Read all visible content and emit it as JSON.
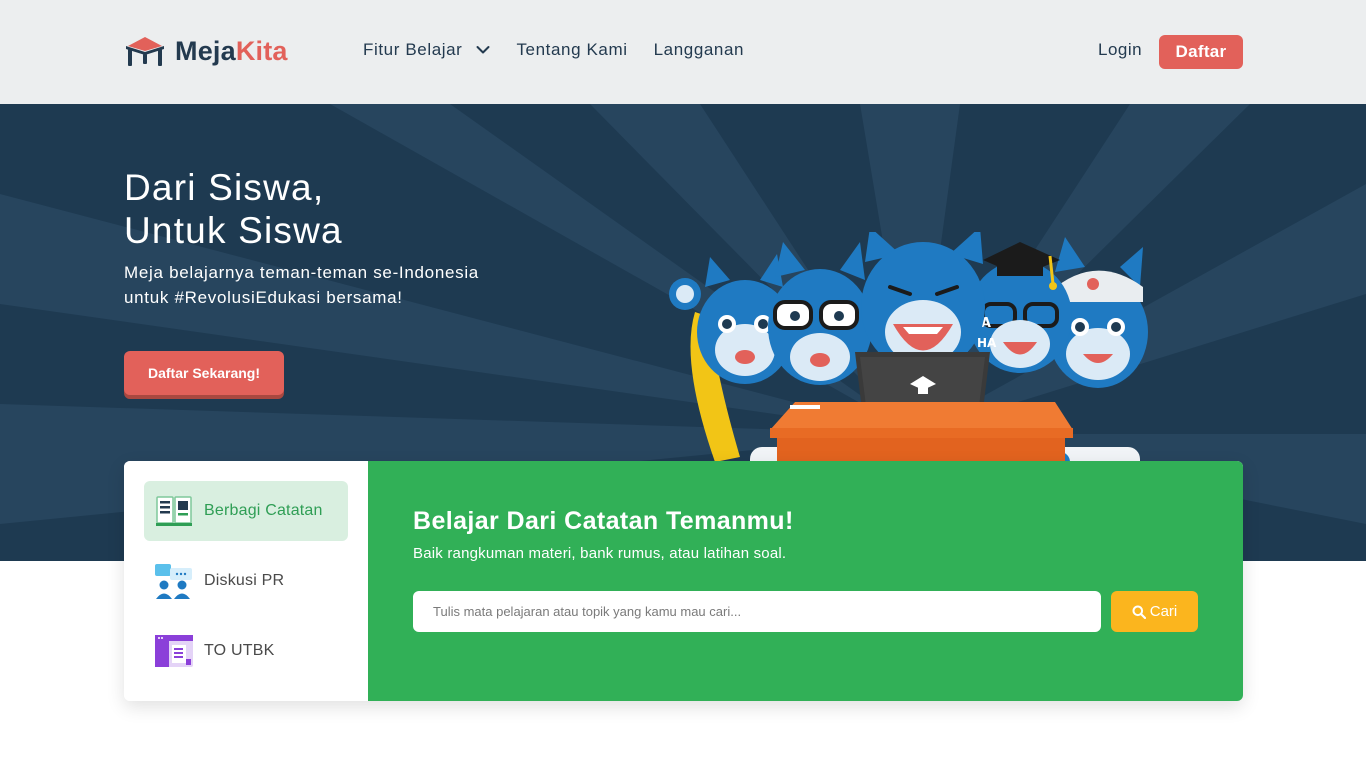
{
  "brand": {
    "name_part1": "Meja",
    "name_part2": "Kita"
  },
  "nav": {
    "items": [
      {
        "label": "Fitur Belajar"
      },
      {
        "label": "Tentang Kami"
      },
      {
        "label": "Langganan"
      }
    ],
    "login_label": "Login",
    "signup_label": "Daftar"
  },
  "hero": {
    "title_line1": "Dari Siswa,",
    "title_line2": "Untuk Siswa",
    "subtitle_line1": "Meja belajarnya teman-teman se-Indonesia",
    "subtitle_line2": "untuk #RevolusiEdukasi bersama!",
    "cta_label": "Daftar Sekarang!"
  },
  "features": {
    "tabs": [
      {
        "label": "Berbagi Catatan",
        "icon": "notes-book-icon",
        "active": true
      },
      {
        "label": "Diskusi PR",
        "icon": "discussion-people-icon",
        "active": false
      },
      {
        "label": "TO UTBK",
        "icon": "exam-window-icon",
        "active": false
      }
    ],
    "content": {
      "title": "Belajar Dari Catatan Temanmu!",
      "subtitle": "Baik rangkuman materi, bank rumus, atau latihan soal.",
      "search_placeholder": "Tulis mata pelajaran atau topik yang kamu mau cari...",
      "search_button_label": "Cari"
    }
  },
  "colors": {
    "navbar_bg": "#eceeef",
    "hero_bg": "#1e3a51",
    "brand_navy": "#233a4f",
    "accent_red": "#e2615a",
    "panel_green": "#31b057",
    "search_yellow": "#fbb51e",
    "active_tab_bg": "#d9efe0"
  }
}
